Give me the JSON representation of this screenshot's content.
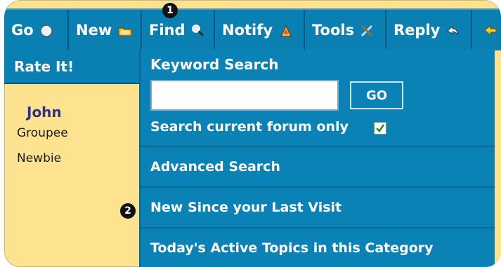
{
  "toolbar": {
    "items": [
      {
        "label": "Go",
        "icon": "compass-icon"
      },
      {
        "label": "New",
        "icon": "folder-icon"
      },
      {
        "label": "Find",
        "icon": "magnifier-icon"
      },
      {
        "label": "Notify",
        "icon": "bell-icon"
      },
      {
        "label": "Tools",
        "icon": "tools-icon"
      },
      {
        "label": "Reply",
        "icon": "reply-icon"
      },
      {
        "label": "",
        "icon": "arrow-icon"
      }
    ]
  },
  "rate": {
    "label": "Rate It!"
  },
  "profile": {
    "name": "John",
    "role1": "Groupee",
    "role2": "Newbie"
  },
  "search_menu": {
    "keyword_title": "Keyword Search",
    "input_value": "",
    "go_label": "GO",
    "checkbox_label": "Search current forum only",
    "checkbox_checked": true,
    "advanced": "Advanced Search",
    "new_since": "New Since your Last Visit",
    "active_topics": "Today's Active Topics in this Category"
  },
  "callouts": {
    "one": "1",
    "two": "2"
  },
  "colors": {
    "toolbar_bg": "#0a7fb1",
    "menu_bg": "#0b82b6",
    "panel_bg": "#fde38f",
    "name_color": "#2f2f8c"
  }
}
